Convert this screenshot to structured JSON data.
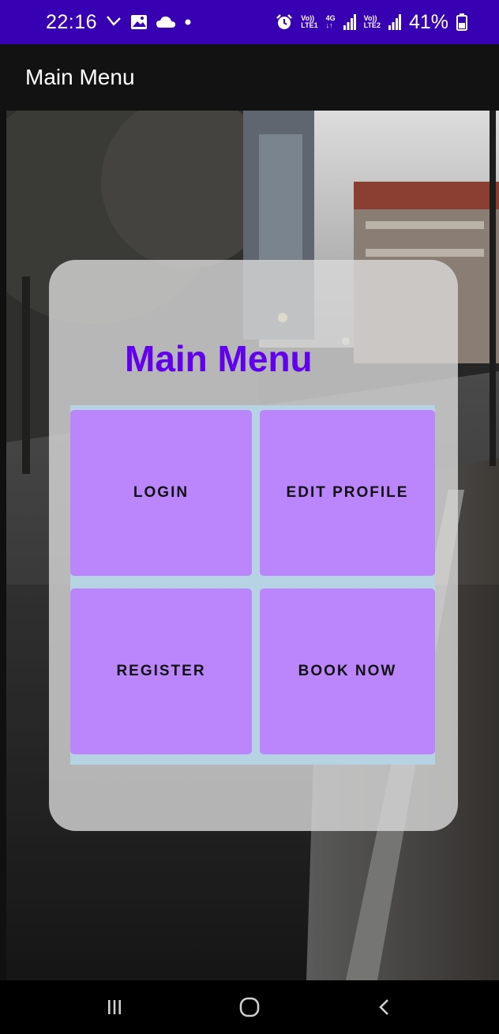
{
  "status_bar": {
    "time": "22:16",
    "left_icons": [
      "missed-call-icon",
      "gallery-icon",
      "cloud-icon",
      "dot-icon"
    ],
    "alarm_icon": "alarm-icon",
    "sim1_top": "Vo))",
    "sim1_bottom": "LTE1",
    "net_top": "4G",
    "net_bottom": "↓↑",
    "sim2_top": "Vo))",
    "sim2_bottom": "LTE2",
    "battery": "41%",
    "colors": {
      "background": "#3700B3",
      "text": "#FFFFFF"
    }
  },
  "app_bar": {
    "title": "Main Menu",
    "colors": {
      "background": "#121212",
      "text": "#FFFFFF"
    }
  },
  "card": {
    "title": "Main Menu",
    "colors": {
      "title": "#6200EE",
      "card": "#DADADA",
      "grid": "#B5D3E2",
      "tile": "#BB86FC"
    },
    "buttons": [
      {
        "label": "LOGIN"
      },
      {
        "label": "EDIT PROFILE"
      },
      {
        "label": "REGISTER"
      },
      {
        "label": "BOOK NOW"
      }
    ]
  },
  "nav_bar": {
    "icons": [
      "recent-apps-icon",
      "home-icon",
      "back-icon"
    ]
  }
}
